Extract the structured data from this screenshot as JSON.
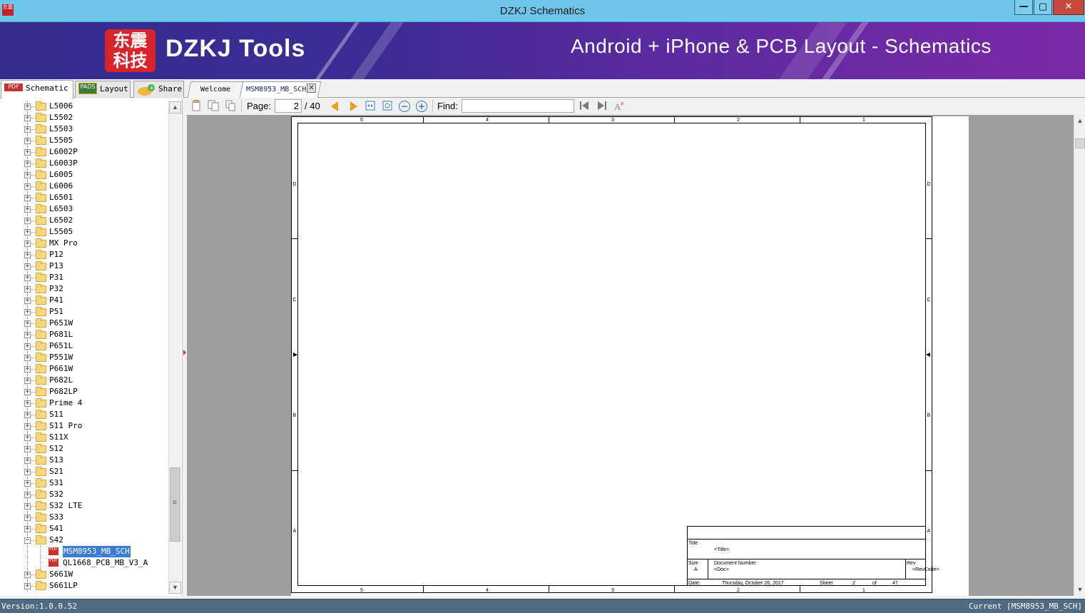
{
  "window": {
    "title": "DZKJ Schematics",
    "app_icon_text": "东震科技",
    "minimize": "—",
    "maximize": "▢",
    "close": "✕"
  },
  "banner": {
    "logo_text": "东震科技",
    "brand": "DZKJ Tools",
    "tagline": "Android + iPhone & PCB Layout - Schematics"
  },
  "mode_tabs": {
    "schematic": "Schematic",
    "layout": "Layout",
    "share": "Share",
    "schematic_badge": "PDF",
    "layout_badge": "PADS"
  },
  "doc_tabs": {
    "welcome": "Welcome",
    "current": "MSM8953_MB_SCH",
    "close_glyph": "✕"
  },
  "tree": {
    "folders": [
      "L5006",
      "L5502",
      "L5503",
      "L5505",
      "L6002P",
      "L6003P",
      "L6005",
      "L6006",
      "L6501",
      "L6503",
      "L6502",
      "L5505",
      "MX Pro",
      "P12",
      "P13",
      "P31",
      "P32",
      "P41",
      "P51",
      "P651W",
      "P681L",
      "P651L",
      "P551W",
      "P661W",
      "P682L",
      "P682LP",
      "Prime 4",
      "S11",
      "S11 Pro",
      "S11X",
      "S12",
      "S13",
      "S21",
      "S31",
      "S32",
      "S32 LTE",
      "S33",
      "S41",
      "S42"
    ],
    "expanded_folder": "S42",
    "children": [
      "MSM8953_MB_SCH",
      "QL1668_PCB_MB_V3_A"
    ],
    "selected_child": "MSM8953_MB_SCH",
    "folders_after": [
      "S661W",
      "S661LP"
    ],
    "plus": "+",
    "minus": "−",
    "pdf_badge": "PDF"
  },
  "toolbar": {
    "page_label": "Page:",
    "page_value": "2",
    "page_total": "/ 40",
    "find_label": "Find:",
    "find_value": ""
  },
  "schematic": {
    "top_columns": [
      "5",
      "4",
      "3",
      "2",
      "1"
    ],
    "bottom_columns": [
      "5",
      "4",
      "3",
      "2",
      "1"
    ],
    "rows": [
      "D",
      "C",
      "B",
      "A"
    ],
    "title_block": {
      "title_label": "Title",
      "title_value": "<Title>",
      "size_label": "Size",
      "size_value": "A",
      "doc_number_label": "Document  Number",
      "doc_number_value": "<Doc>",
      "rev_label": "Rev",
      "rev_value": "<RevCode>",
      "date_label": "Date:",
      "date_value": "Thursday, October 26, 2017",
      "sheet_label": "Sheet",
      "sheet_value": "2",
      "of_label": "of",
      "sheet_total": "47"
    }
  },
  "status": {
    "version": "Version:1.0.0.52",
    "current": "Current [MSM8953_MB_SCH]"
  },
  "colors": {
    "titlebar": "#6ec6ea",
    "banner_start": "#332e8e",
    "banner_end": "#7b2aa6",
    "statusbar": "#4f6b84",
    "selection": "#3a7bd5",
    "viewer_bg": "#9e9e9e"
  }
}
